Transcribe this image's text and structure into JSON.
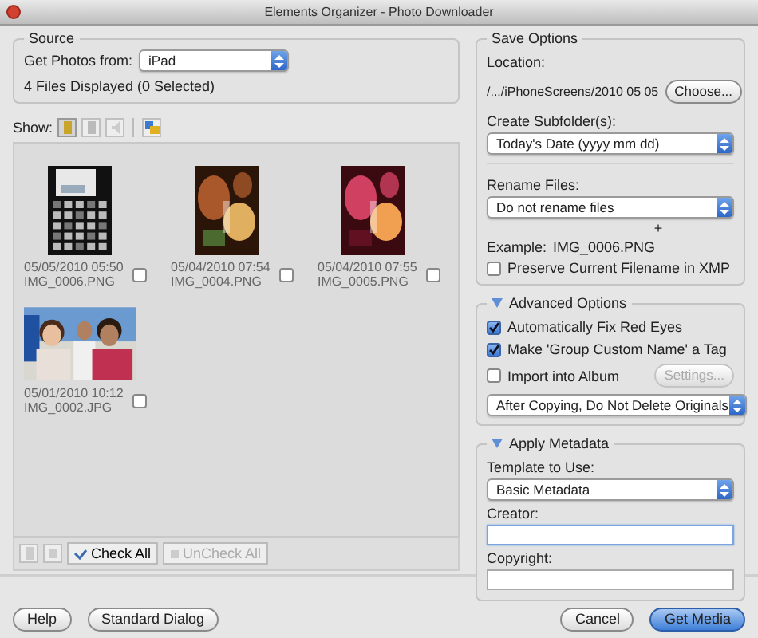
{
  "window": {
    "title": "Elements Organizer - Photo Downloader"
  },
  "source": {
    "title": "Source",
    "get_from_label": "Get Photos from:",
    "device": "iPad",
    "status": "4 Files Displayed (0 Selected)"
  },
  "show": {
    "label": "Show:"
  },
  "photos": [
    {
      "date": "05/05/2010 05:50",
      "name": "IMG_0006.PNG",
      "checked": false,
      "kind": "portrait"
    },
    {
      "date": "05/04/2010 07:54",
      "name": "IMG_0004.PNG",
      "checked": false,
      "kind": "portrait"
    },
    {
      "date": "05/04/2010 07:55",
      "name": "IMG_0005.PNG",
      "checked": false,
      "kind": "portrait"
    },
    {
      "date": "05/01/2010 10:12",
      "name": "IMG_0002.JPG",
      "checked": false,
      "kind": "landscape"
    }
  ],
  "grid_toolbar": {
    "check_all": "Check All",
    "uncheck_all": "UnCheck All",
    "uncheck_disabled": true
  },
  "save_options": {
    "title": "Save Options",
    "location_label": "Location:",
    "location": "/.../iPhoneScreens/2010 05 05",
    "choose": "Choose...",
    "subfolder_label": "Create Subfolder(s):",
    "subfolder": "Today's Date (yyyy mm dd)",
    "rename_label": "Rename Files:",
    "rename": "Do not rename files",
    "plus": "+",
    "example_label": "Example:",
    "example": "IMG_0006.PNG",
    "preserve": {
      "label": "Preserve Current Filename in XMP",
      "checked": false
    }
  },
  "advanced": {
    "title": "Advanced Options",
    "expanded": true,
    "options": [
      {
        "label": "Automatically Fix Red Eyes",
        "checked": true
      },
      {
        "label": "Make 'Group Custom Name' a Tag",
        "checked": true
      },
      {
        "label": "Import into Album",
        "checked": false
      }
    ],
    "settings": {
      "label": "Settings...",
      "disabled": true
    },
    "after_copy": "After Copying, Do Not Delete Originals"
  },
  "metadata": {
    "title": "Apply Metadata",
    "expanded": true,
    "template_label": "Template to Use:",
    "template": "Basic Metadata",
    "creator_label": "Creator:",
    "copyright_label": "Copyright:"
  },
  "footer": {
    "help": "Help",
    "standard_dialog": "Standard Dialog",
    "cancel": "Cancel",
    "get_media": "Get Media"
  }
}
